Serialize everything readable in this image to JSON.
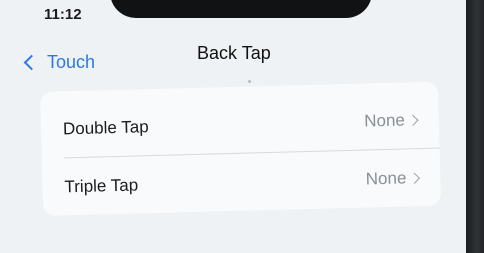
{
  "status_bar": {
    "time": "11:12"
  },
  "nav": {
    "back_label": "Touch",
    "title": "Back Tap"
  },
  "settings": {
    "rows": [
      {
        "label": "Double Tap",
        "value": "None"
      },
      {
        "label": "Triple Tap",
        "value": "None"
      }
    ]
  },
  "colors": {
    "accent": "#2a7ae0",
    "background": "#eef2f5",
    "group_background": "#f8fafb",
    "secondary_text": "#8a8f96"
  },
  "icons": [
    "chevron-left-icon",
    "chevron-right-icon"
  ]
}
